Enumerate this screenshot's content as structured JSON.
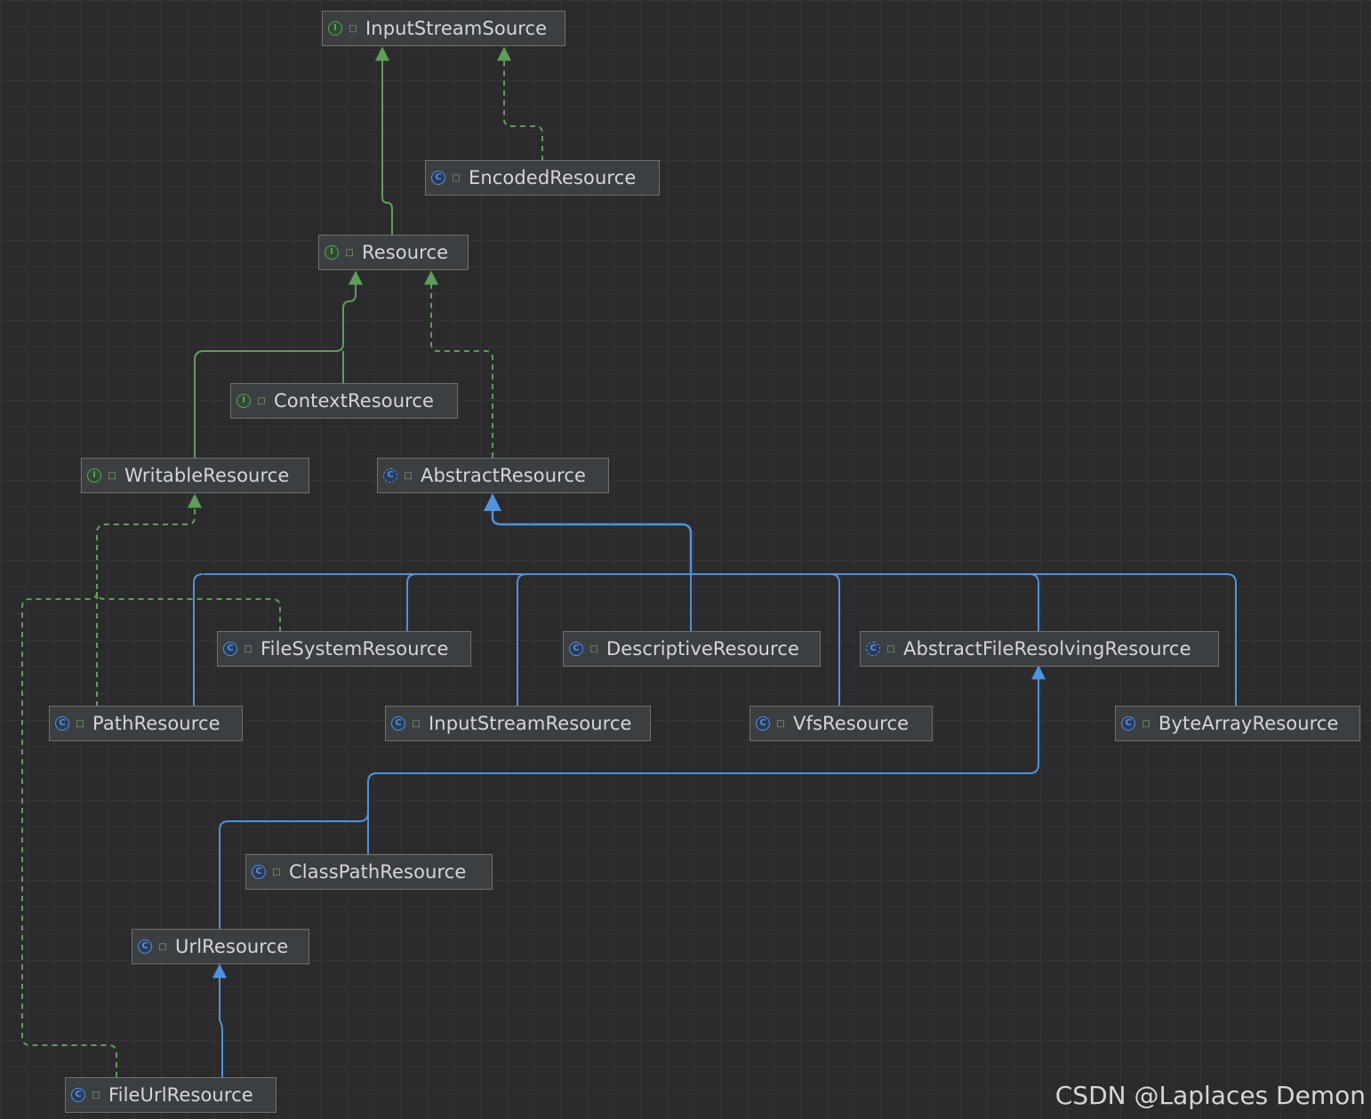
{
  "colors": {
    "background": "#2b2b2d",
    "node_fill": "#3c3f41",
    "node_border": "#707070",
    "interface_edge": "#5f9e58",
    "class_edge": "#4f93dc",
    "text": "#d4d6da"
  },
  "nodes": [
    {
      "id": "InputStreamSource",
      "label": "InputStreamSource",
      "kind": "interface",
      "kind_letter": "I",
      "visibility_icon": "unlock-icon"
    },
    {
      "id": "EncodedResource",
      "label": "EncodedResource",
      "kind": "class",
      "kind_letter": "C",
      "visibility_icon": "unlock-icon"
    },
    {
      "id": "Resource",
      "label": "Resource",
      "kind": "interface",
      "kind_letter": "I",
      "visibility_icon": "unlock-icon"
    },
    {
      "id": "ContextResource",
      "label": "ContextResource",
      "kind": "interface",
      "kind_letter": "I",
      "visibility_icon": "unlock-icon"
    },
    {
      "id": "WritableResource",
      "label": "WritableResource",
      "kind": "interface",
      "kind_letter": "I",
      "visibility_icon": "unlock-icon"
    },
    {
      "id": "AbstractResource",
      "label": "AbstractResource",
      "kind": "abstract-class",
      "kind_letter": "C",
      "visibility_icon": "unlock-icon"
    },
    {
      "id": "FileSystemResource",
      "label": "FileSystemResource",
      "kind": "class",
      "kind_letter": "C",
      "visibility_icon": "unlock-icon"
    },
    {
      "id": "DescriptiveResource",
      "label": "DescriptiveResource",
      "kind": "class",
      "kind_letter": "C",
      "visibility_icon": "unlock-icon"
    },
    {
      "id": "AbstractFileResolvingResource",
      "label": "AbstractFileResolvingResource",
      "kind": "abstract-class",
      "kind_letter": "C",
      "visibility_icon": "unlock-icon"
    },
    {
      "id": "PathResource",
      "label": "PathResource",
      "kind": "class",
      "kind_letter": "C",
      "visibility_icon": "unlock-icon"
    },
    {
      "id": "InputStreamResource",
      "label": "InputStreamResource",
      "kind": "class",
      "kind_letter": "C",
      "visibility_icon": "unlock-icon"
    },
    {
      "id": "VfsResource",
      "label": "VfsResource",
      "kind": "class",
      "kind_letter": "C",
      "visibility_icon": "unlock-icon"
    },
    {
      "id": "ByteArrayResource",
      "label": "ByteArrayResource",
      "kind": "class",
      "kind_letter": "C",
      "visibility_icon": "unlock-icon"
    },
    {
      "id": "ClassPathResource",
      "label": "ClassPathResource",
      "kind": "class",
      "kind_letter": "C",
      "visibility_icon": "unlock-icon"
    },
    {
      "id": "UrlResource",
      "label": "UrlResource",
      "kind": "class",
      "kind_letter": "C",
      "visibility_icon": "unlock-icon"
    },
    {
      "id": "FileUrlResource",
      "label": "FileUrlResource",
      "kind": "class",
      "kind_letter": "C",
      "visibility_icon": "unlock-icon"
    }
  ],
  "edges": [
    {
      "from": "Resource",
      "to": "InputStreamSource",
      "relation": "extends",
      "style": "solid",
      "color": "green"
    },
    {
      "from": "EncodedResource",
      "to": "InputStreamSource",
      "relation": "implements",
      "style": "dashed",
      "color": "green"
    },
    {
      "from": "ContextResource",
      "to": "Resource",
      "relation": "extends",
      "style": "solid",
      "color": "green"
    },
    {
      "from": "WritableResource",
      "to": "Resource",
      "relation": "extends",
      "style": "solid",
      "color": "green"
    },
    {
      "from": "AbstractResource",
      "to": "Resource",
      "relation": "implements",
      "style": "dashed",
      "color": "green"
    },
    {
      "from": "PathResource",
      "to": "WritableResource",
      "relation": "implements",
      "style": "dashed",
      "color": "green"
    },
    {
      "from": "FileSystemResource",
      "to": "WritableResource",
      "relation": "implements",
      "style": "dashed",
      "color": "green"
    },
    {
      "from": "FileUrlResource",
      "to": "WritableResource",
      "relation": "implements",
      "style": "dashed",
      "color": "green"
    },
    {
      "from": "PathResource",
      "to": "AbstractResource",
      "relation": "extends",
      "style": "solid",
      "color": "blue"
    },
    {
      "from": "FileSystemResource",
      "to": "AbstractResource",
      "relation": "extends",
      "style": "solid",
      "color": "blue"
    },
    {
      "from": "InputStreamResource",
      "to": "AbstractResource",
      "relation": "extends",
      "style": "solid",
      "color": "blue"
    },
    {
      "from": "DescriptiveResource",
      "to": "AbstractResource",
      "relation": "extends",
      "style": "solid",
      "color": "blue"
    },
    {
      "from": "VfsResource",
      "to": "AbstractResource",
      "relation": "extends",
      "style": "solid",
      "color": "blue"
    },
    {
      "from": "AbstractFileResolvingResource",
      "to": "AbstractResource",
      "relation": "extends",
      "style": "solid",
      "color": "blue"
    },
    {
      "from": "ByteArrayResource",
      "to": "AbstractResource",
      "relation": "extends",
      "style": "solid",
      "color": "blue"
    },
    {
      "from": "ClassPathResource",
      "to": "AbstractFileResolvingResource",
      "relation": "extends",
      "style": "solid",
      "color": "blue"
    },
    {
      "from": "UrlResource",
      "to": "AbstractFileResolvingResource",
      "relation": "extends",
      "style": "solid",
      "color": "blue"
    },
    {
      "from": "FileUrlResource",
      "to": "UrlResource",
      "relation": "extends",
      "style": "solid",
      "color": "blue"
    }
  ],
  "watermark": "CSDN @Laplaces Demon"
}
